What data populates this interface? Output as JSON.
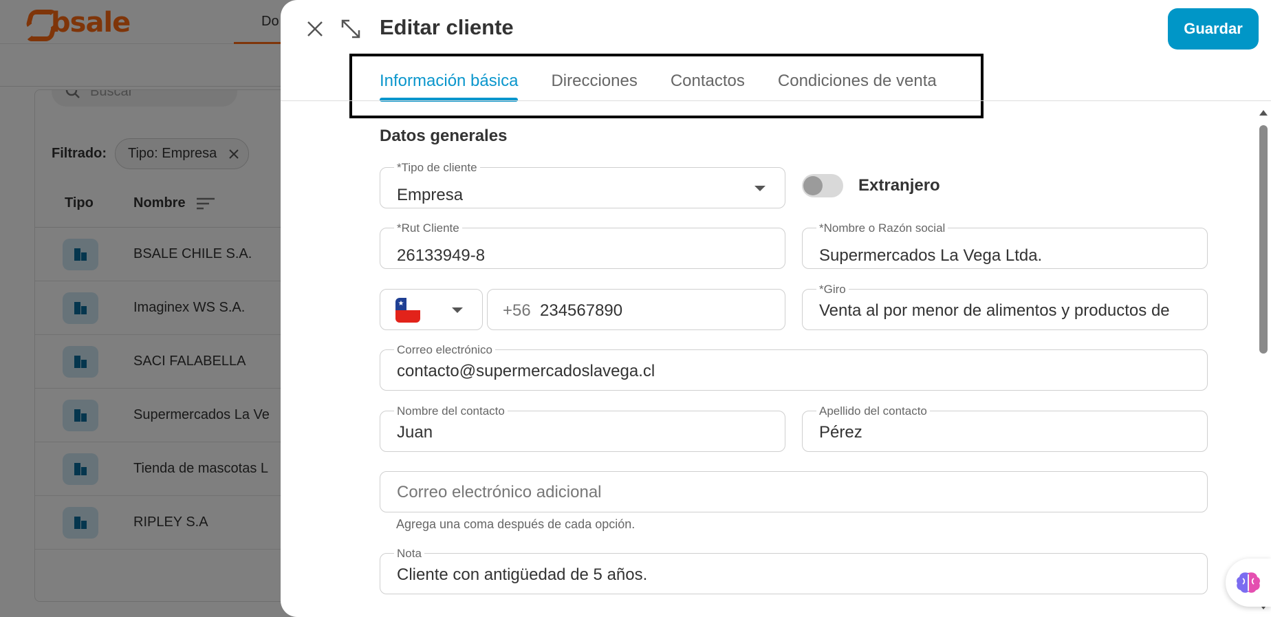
{
  "background": {
    "logo_text": "bsale",
    "nav_tab_label": "Do",
    "search_placeholder": "Buscar",
    "filter_label": "Filtrado:",
    "filter_chip": "Tipo: Empresa",
    "columns": {
      "tipo": "Tipo",
      "nombre": "Nombre"
    },
    "rows": [
      {
        "name": "BSALE CHILE S.A."
      },
      {
        "name": "Imaginex WS S.A."
      },
      {
        "name": "SACI FALABELLA"
      },
      {
        "name": "Supermercados La Ve"
      },
      {
        "name": "Tienda de mascotas L"
      },
      {
        "name": "RIPLEY S.A"
      }
    ]
  },
  "drawer": {
    "title": "Editar cliente",
    "save_label": "Guardar",
    "tabs": [
      {
        "label": "Información básica",
        "active": true
      },
      {
        "label": "Direcciones",
        "active": false
      },
      {
        "label": "Contactos",
        "active": false
      },
      {
        "label": "Condiciones de venta",
        "active": false
      }
    ],
    "section_title": "Datos generales",
    "form": {
      "tipo_cliente": {
        "label": "*Tipo de cliente",
        "value": "Empresa"
      },
      "extranjero": {
        "label": "Extranjero",
        "checked": false
      },
      "rut": {
        "label": "*Rut Cliente",
        "value": "26133949-8"
      },
      "razon_social": {
        "label": "*Nombre o Razón social",
        "value": "Supermercados La Vega Ltda."
      },
      "phone": {
        "country_code": "+56",
        "value": "234567890"
      },
      "giro": {
        "label": "*Giro",
        "value": "Venta al por menor de alimentos y productos de"
      },
      "email": {
        "label": "Correo electrónico",
        "value": "contacto@supermercadoslavega.cl"
      },
      "contact_name": {
        "label": "Nombre del contacto",
        "value": "Juan"
      },
      "contact_lastname": {
        "label": "Apellido del contacto",
        "value": "Pérez"
      },
      "extra_email": {
        "placeholder": "Correo electrónico adicional",
        "helper": "Agrega una coma después de cada opción."
      },
      "nota": {
        "label": "Nota",
        "value": "Cliente con antigüedad de 5 años."
      }
    }
  },
  "colors": {
    "accent": "#0a96cc",
    "save_button": "#0096c7",
    "brand_orange": "#ff6a13"
  },
  "icons": {
    "close": "close-icon",
    "expand": "expand-icon",
    "ai": "brain-icon"
  }
}
